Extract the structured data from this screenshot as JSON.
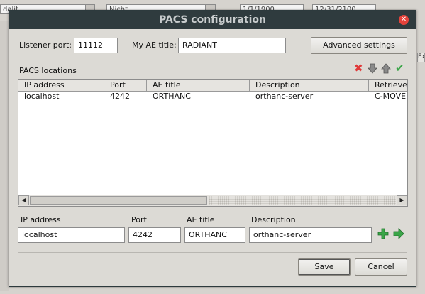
{
  "background": {
    "fields": [
      "dalit",
      "Nicht",
      "1/1/1900",
      "12/31/2100"
    ],
    "side_label": "",
    "right_tab": "Exa"
  },
  "dialog": {
    "title": "PACS configuration",
    "listener_port_label": "Listener port:",
    "listener_port_value": "11112",
    "ae_title_label": "My AE title:",
    "ae_title_value": "RADIANT",
    "advanced_button": "Advanced settings",
    "locations_label": "PACS locations",
    "table": {
      "columns": [
        "IP address",
        "Port",
        "AE title",
        "Description",
        "Retrieve"
      ],
      "rows": [
        [
          "localhost",
          "4242",
          "ORTHANC",
          "orthanc-server",
          "C-MOVE"
        ]
      ]
    },
    "form": {
      "ip_label": "IP address",
      "port_label": "Port",
      "ae_label": "AE title",
      "desc_label": "Description",
      "ip_value": "localhost",
      "port_value": "4242",
      "ae_value": "ORTHANC",
      "desc_value": "orthanc-server"
    },
    "save_button": "Save",
    "cancel_button": "Cancel"
  },
  "colors": {
    "titlebar": "#2f3b3e",
    "close": "#e4433b",
    "delete_icon": "#e03a3a",
    "add_icon": "#3aa548",
    "check_icon": "#3aa548"
  }
}
